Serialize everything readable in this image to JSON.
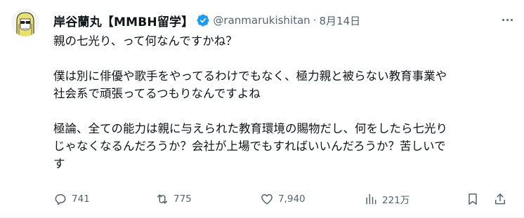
{
  "author": {
    "display_name": "岸谷蘭丸【MMBH留学】",
    "handle": "@ranmarukishitan",
    "separator": "·",
    "date": "8月14日"
  },
  "tweet": {
    "line1": "親の七光り、って何なんですかね？",
    "line2": "僕は別に俳優や歌手をやってるわけでもなく、極力親と被らない教育事業や",
    "line3": "社会系で頑張ってるつもりなんですよね",
    "line4": "極論、全ての能力は親に与えられた教育環境の賜物だし、何をしたら七光り",
    "line5": "じゃなくなるんだろうか？会社が上場でもすればいいんだろうか？苦しいで",
    "line6": "す"
  },
  "actions": {
    "reply_count": "741",
    "repost_count": "775",
    "like_count": "7,940",
    "views_count": "221万"
  },
  "icons": {
    "verified": "verified-badge-icon",
    "more": "more-icon",
    "reply": "reply-icon",
    "repost": "repost-icon",
    "like": "heart-icon",
    "views": "views-icon",
    "bookmark": "bookmark-icon",
    "share": "share-icon"
  },
  "colors": {
    "text": "#0f1419",
    "secondary": "#536471",
    "verified": "#1d9bf0"
  }
}
